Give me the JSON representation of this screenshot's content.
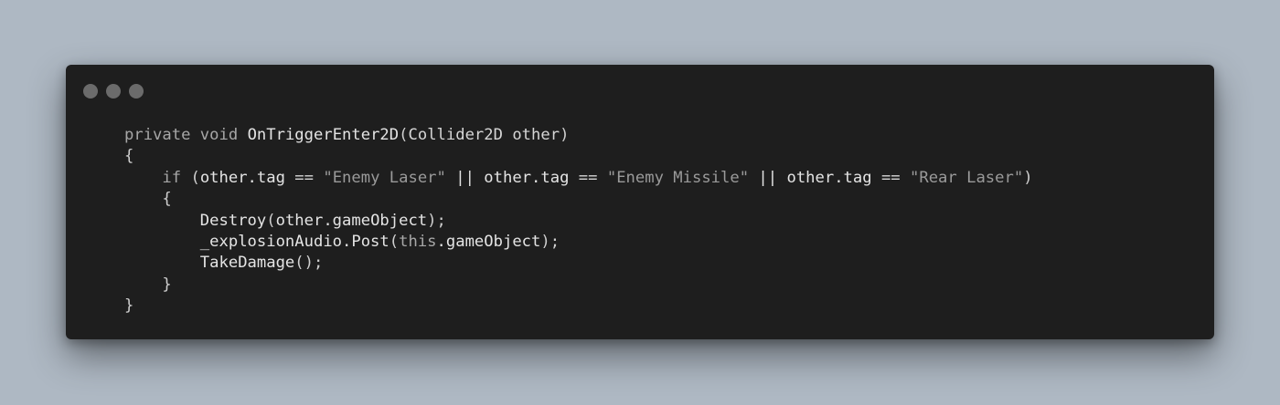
{
  "window": {
    "traffic_lights": [
      "close",
      "minimize",
      "maximize"
    ]
  },
  "code": {
    "language": "C#",
    "lines": [
      [
        {
          "t": "private",
          "k": "kw"
        },
        {
          "t": " ",
          "k": "plain"
        },
        {
          "t": "void",
          "k": "kw"
        },
        {
          "t": " ",
          "k": "plain"
        },
        {
          "t": "OnTriggerEnter2D",
          "k": "fn"
        },
        {
          "t": "(",
          "k": "punc"
        },
        {
          "t": "Collider2D other",
          "k": "plain"
        },
        {
          "t": ")",
          "k": "punc"
        }
      ],
      [
        {
          "t": "{",
          "k": "punc"
        }
      ],
      [
        {
          "t": "    ",
          "k": "plain"
        },
        {
          "t": "if",
          "k": "kw"
        },
        {
          "t": " (",
          "k": "punc"
        },
        {
          "t": "other.tag",
          "k": "fn"
        },
        {
          "t": " == ",
          "k": "plain"
        },
        {
          "t": "\"Enemy Laser\"",
          "k": "str"
        },
        {
          "t": " || ",
          "k": "fn"
        },
        {
          "t": "other.tag",
          "k": "fn"
        },
        {
          "t": " == ",
          "k": "plain"
        },
        {
          "t": "\"Enemy Missile\"",
          "k": "str"
        },
        {
          "t": " || ",
          "k": "fn"
        },
        {
          "t": "other.tag",
          "k": "fn"
        },
        {
          "t": " == ",
          "k": "plain"
        },
        {
          "t": "\"Rear Laser\"",
          "k": "str"
        },
        {
          "t": ")",
          "k": "punc"
        }
      ],
      [
        {
          "t": "    {",
          "k": "punc"
        }
      ],
      [
        {
          "t": "        ",
          "k": "plain"
        },
        {
          "t": "Destroy",
          "k": "fn"
        },
        {
          "t": "(",
          "k": "punc"
        },
        {
          "t": "other.gameObject",
          "k": "fn"
        },
        {
          "t": ");",
          "k": "punc"
        }
      ],
      [
        {
          "t": "        ",
          "k": "plain"
        },
        {
          "t": "_explosionAudio.Post",
          "k": "fn"
        },
        {
          "t": "(",
          "k": "punc"
        },
        {
          "t": "this",
          "k": "kw"
        },
        {
          "t": ".gameObject",
          "k": "fn"
        },
        {
          "t": ");",
          "k": "punc"
        }
      ],
      [
        {
          "t": "        ",
          "k": "plain"
        },
        {
          "t": "TakeDamage",
          "k": "fn"
        },
        {
          "t": "();",
          "k": "punc"
        }
      ],
      [
        {
          "t": "    }",
          "k": "punc"
        }
      ],
      [
        {
          "t": "}",
          "k": "punc"
        }
      ]
    ]
  },
  "colors": {
    "background": "#aeb8c3",
    "window": "#1e1e1e",
    "traffic_light": "#6b6b6b"
  }
}
